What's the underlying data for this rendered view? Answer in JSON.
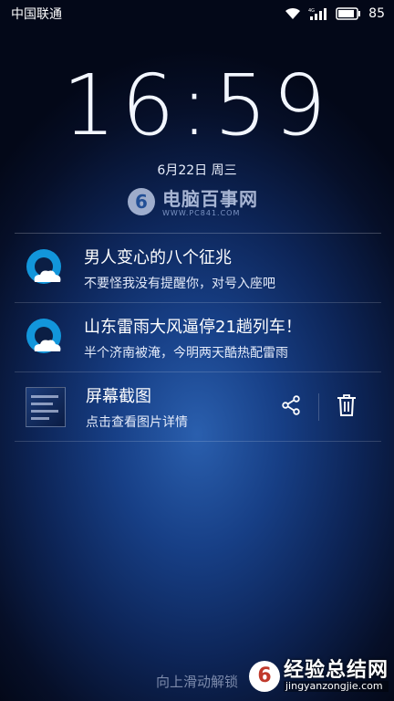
{
  "status_bar": {
    "carrier": "中国联通",
    "battery": "85",
    "icons": [
      "wifi-icon",
      "signal-icon",
      "battery-icon"
    ]
  },
  "lockscreen": {
    "time_hours": "16",
    "time_minutes": "59",
    "date": "6月22日  周三",
    "unlock_hint": "向上滑动解锁"
  },
  "watermark": {
    "title": "电脑百事网",
    "url": "WWW.PC841.COM"
  },
  "notifications": [
    {
      "app_icon": "qq-browser-icon",
      "title": "男人变心的八个征兆",
      "body": "不要怪我没有提醒你，对号入座吧"
    },
    {
      "app_icon": "qq-browser-icon",
      "title": "山东雷雨大风逼停21趟列车！",
      "body": "半个济南被淹，今明两天酷热配雷雨"
    },
    {
      "app_icon": "screenshot-thumbnail",
      "title": "屏幕截图",
      "body": "点击查看图片详情",
      "actions": [
        "share-icon",
        "delete-icon"
      ]
    }
  ],
  "corner_watermark": {
    "title": "经验总结网",
    "url": "jingyanzongjie.com"
  },
  "colors": {
    "background_center": "#2a5fae",
    "background_edge": "#030818",
    "qq_icon_blue": "#1296db"
  }
}
